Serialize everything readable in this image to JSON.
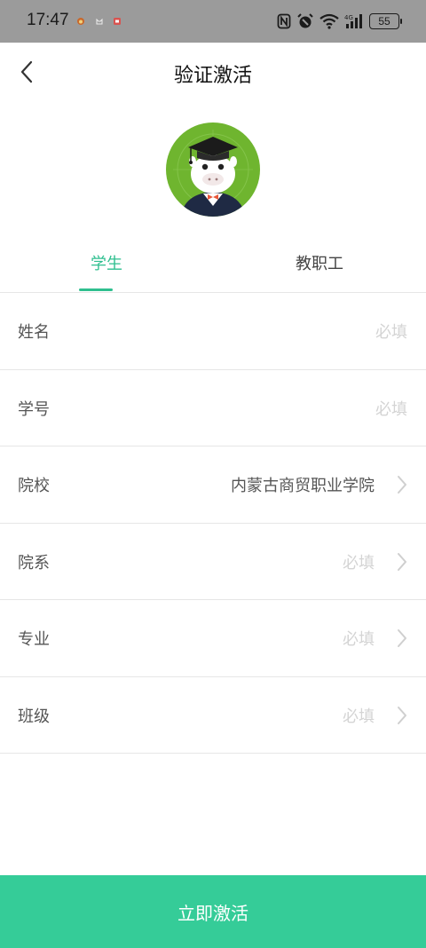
{
  "status_bar": {
    "time": "17:47",
    "battery": "55",
    "icons": [
      "weibo-icon",
      "cat-icon",
      "app-icon",
      "nfc-icon",
      "alarm-icon",
      "wifi-icon",
      "signal-4g-icon",
      "battery-icon"
    ]
  },
  "header": {
    "title": "验证激活",
    "back_icon": "chevron-left-icon"
  },
  "avatar": {
    "icon": "graduate-mascot-avatar"
  },
  "tabs": [
    {
      "label": "学生",
      "active": true
    },
    {
      "label": "教职工",
      "active": false
    }
  ],
  "form": {
    "rows": [
      {
        "label": "姓名",
        "value": "",
        "placeholder": "必填"
      },
      {
        "label": "学号",
        "value": "",
        "placeholder": "必填"
      },
      {
        "label": "院校",
        "value": "内蒙古商贸职业学院",
        "placeholder": ""
      },
      {
        "label": "院系",
        "value": "",
        "placeholder": "必填"
      },
      {
        "label": "专业",
        "value": "",
        "placeholder": "必填"
      },
      {
        "label": "班级",
        "value": "",
        "placeholder": "必填"
      }
    ]
  },
  "activate_button": {
    "label": "立即激活"
  },
  "colors": {
    "accent": "#2fbf8f",
    "button": "#35cc98",
    "status_bar": "#9b9b9b"
  }
}
